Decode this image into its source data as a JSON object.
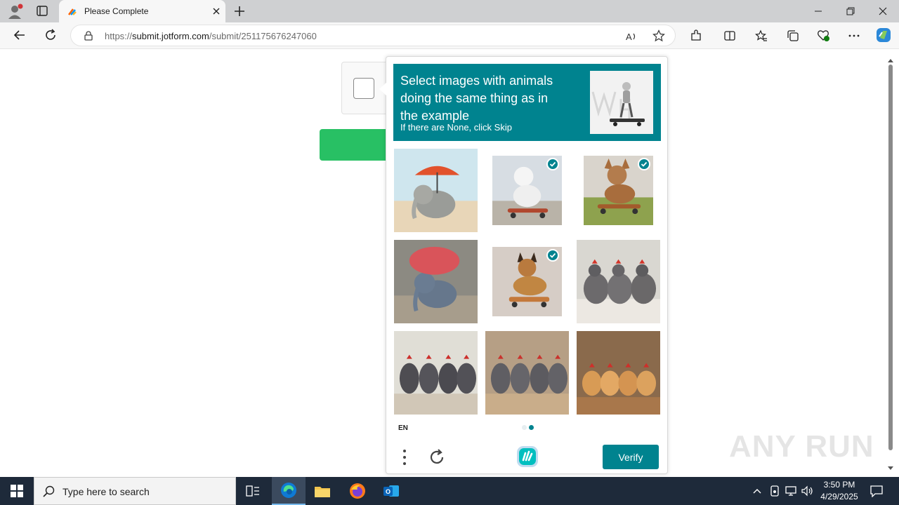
{
  "browser": {
    "tab_title": "Please Complete",
    "url_prefix": "https://",
    "url_domain": "submit.jotform.com",
    "url_path": "/submit/251175676247060"
  },
  "challenge": {
    "prompt": "Select images with animals doing the same thing as in the example",
    "sub_prompt": "If there are None, click Skip",
    "accent_color": "#00838f",
    "language": "EN",
    "verify_label": "Verify",
    "tiles": [
      {
        "subject": "elephant with red umbrella",
        "selected": false
      },
      {
        "subject": "poodle on skateboard",
        "selected": true
      },
      {
        "subject": "dog on skateboard",
        "selected": true
      },
      {
        "subject": "elephant with red umbrella",
        "selected": false
      },
      {
        "subject": "german shepherd on skateboard",
        "selected": true
      },
      {
        "subject": "chickens",
        "selected": false
      },
      {
        "subject": "chickens",
        "selected": false
      },
      {
        "subject": "chickens",
        "selected": false
      },
      {
        "subject": "chickens",
        "selected": false
      }
    ],
    "page_indicator": {
      "current": 2,
      "total": 2
    }
  },
  "page": {
    "submit_color": "#28c064"
  },
  "watermark": "ANY RUN",
  "taskbar": {
    "search_placeholder": "Type here to search",
    "time": "3:50 PM",
    "date": "4/29/2025"
  }
}
